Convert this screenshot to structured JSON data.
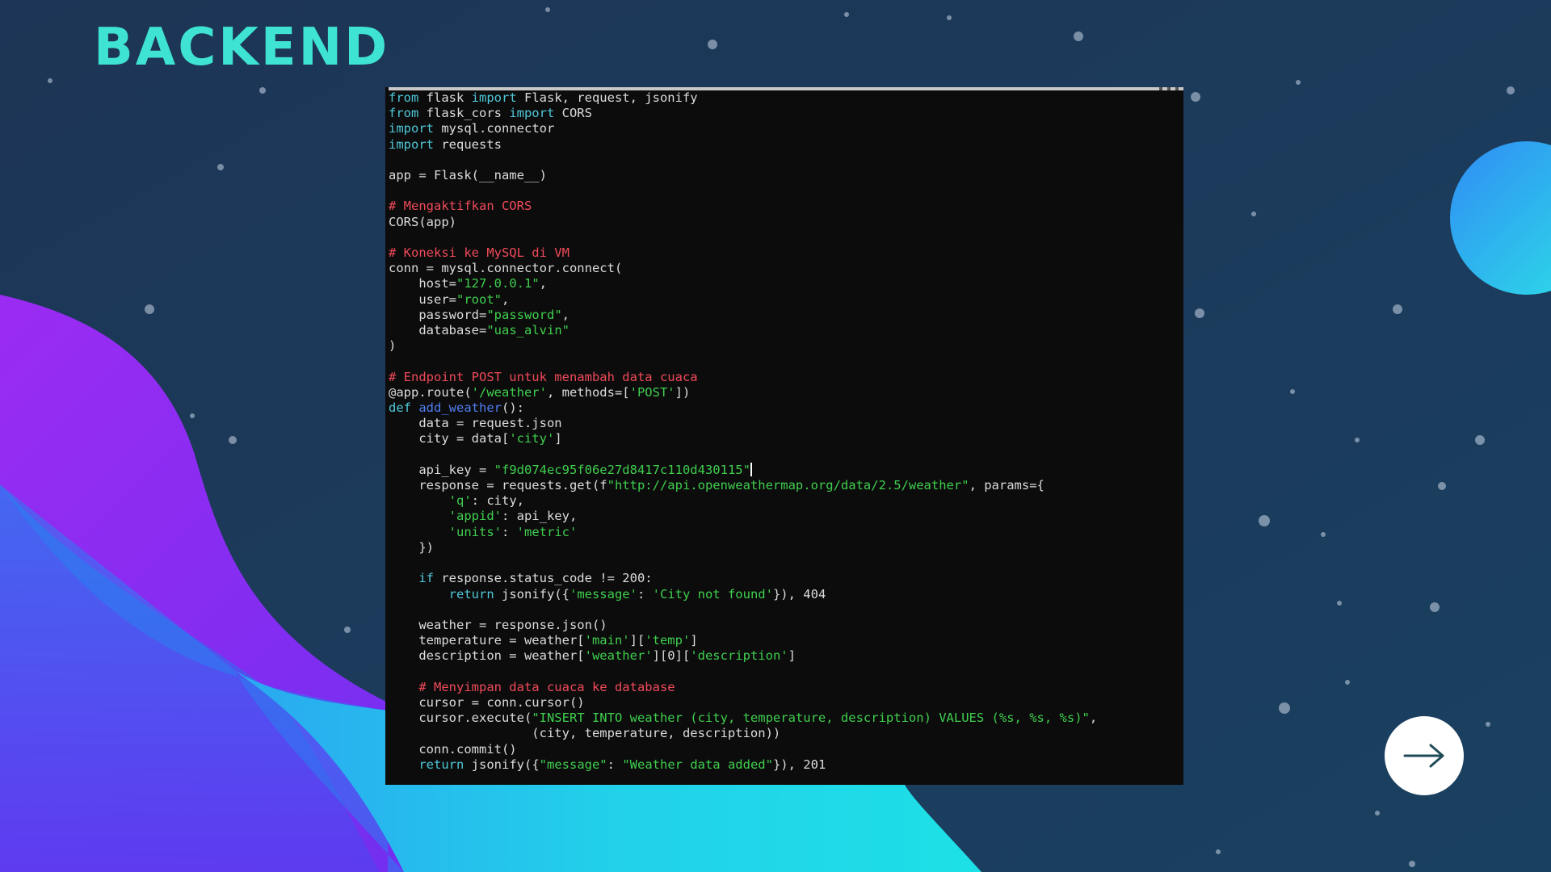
{
  "slide": {
    "title": "BACKEND",
    "accent_color": "#3ee3d4",
    "next_icon": "arrow-right-icon"
  },
  "code": {
    "lines": [
      [
        [
          "kw",
          "from"
        ],
        [
          "t",
          " flask "
        ],
        [
          "kw",
          "import"
        ],
        [
          "t",
          " Flask, request, jsonify"
        ]
      ],
      [
        [
          "kw",
          "from"
        ],
        [
          "t",
          " flask_cors "
        ],
        [
          "kw",
          "import"
        ],
        [
          "t",
          " CORS"
        ]
      ],
      [
        [
          "kw",
          "import"
        ],
        [
          "t",
          " mysql.connector"
        ]
      ],
      [
        [
          "kw",
          "import"
        ],
        [
          "t",
          " requests"
        ]
      ],
      [],
      [
        [
          "t",
          "app = Flask(__name__)"
        ]
      ],
      [],
      [
        [
          "cm",
          "# Mengaktifkan CORS"
        ]
      ],
      [
        [
          "t",
          "CORS(app)"
        ]
      ],
      [],
      [
        [
          "cm",
          "# Koneksi ke MySQL di VM"
        ]
      ],
      [
        [
          "t",
          "conn = mysql.connector.connect("
        ]
      ],
      [
        [
          "t",
          "    host="
        ],
        [
          "st",
          "\"127.0.0.1\""
        ],
        [
          "t",
          ","
        ]
      ],
      [
        [
          "t",
          "    user="
        ],
        [
          "st",
          "\"root\""
        ],
        [
          "t",
          ","
        ]
      ],
      [
        [
          "t",
          "    password="
        ],
        [
          "st",
          "\"password\""
        ],
        [
          "t",
          ","
        ]
      ],
      [
        [
          "t",
          "    database="
        ],
        [
          "st",
          "\"uas_alvin\""
        ]
      ],
      [
        [
          "t",
          ")"
        ]
      ],
      [],
      [
        [
          "cm",
          "# Endpoint POST untuk menambah data cuaca"
        ]
      ],
      [
        [
          "t",
          "@app.route("
        ],
        [
          "st",
          "'/weather'"
        ],
        [
          "t",
          ", methods=["
        ],
        [
          "st",
          "'POST'"
        ],
        [
          "t",
          "])"
        ]
      ],
      [
        [
          "kw",
          "def"
        ],
        [
          "t",
          " "
        ],
        [
          "fn",
          "add_weather"
        ],
        [
          "t",
          "():"
        ]
      ],
      [
        [
          "t",
          "    data = request.json"
        ]
      ],
      [
        [
          "t",
          "    city = data["
        ],
        [
          "st",
          "'city'"
        ],
        [
          "t",
          "]"
        ]
      ],
      [],
      [
        [
          "t",
          "    api_key = "
        ],
        [
          "st",
          "\"f9d074ec95f06e27d8417c110d430115\""
        ],
        [
          "caret",
          ""
        ]
      ],
      [
        [
          "t",
          "    response = requests.get(f"
        ],
        [
          "st",
          "\"http://api.openweathermap.org/data/2.5/weather\""
        ],
        [
          "t",
          ", params={"
        ]
      ],
      [
        [
          "t",
          "        "
        ],
        [
          "st",
          "'q'"
        ],
        [
          "t",
          ": city,"
        ]
      ],
      [
        [
          "t",
          "        "
        ],
        [
          "st",
          "'appid'"
        ],
        [
          "t",
          ": api_key,"
        ]
      ],
      [
        [
          "t",
          "        "
        ],
        [
          "st",
          "'units'"
        ],
        [
          "t",
          ": "
        ],
        [
          "st",
          "'metric'"
        ]
      ],
      [
        [
          "t",
          "    })"
        ]
      ],
      [],
      [
        [
          "t",
          "    "
        ],
        [
          "kw",
          "if"
        ],
        [
          "t",
          " response.status_code != 200:"
        ]
      ],
      [
        [
          "t",
          "        "
        ],
        [
          "kw",
          "return"
        ],
        [
          "t",
          " jsonify({"
        ],
        [
          "st",
          "'message'"
        ],
        [
          "t",
          ": "
        ],
        [
          "st",
          "'City not found'"
        ],
        [
          "t",
          "}), 404"
        ]
      ],
      [],
      [
        [
          "t",
          "    weather = response.json()"
        ]
      ],
      [
        [
          "t",
          "    temperature = weather["
        ],
        [
          "st",
          "'main'"
        ],
        [
          "t",
          "]["
        ],
        [
          "st",
          "'temp'"
        ],
        [
          "t",
          "]"
        ]
      ],
      [
        [
          "t",
          "    description = weather["
        ],
        [
          "st",
          "'weather'"
        ],
        [
          "t",
          "][0]["
        ],
        [
          "st",
          "'description'"
        ],
        [
          "t",
          "]"
        ]
      ],
      [],
      [
        [
          "t",
          "    "
        ],
        [
          "cm",
          "# Menyimpan data cuaca ke database"
        ]
      ],
      [
        [
          "t",
          "    cursor = conn.cursor()"
        ]
      ],
      [
        [
          "t",
          "    cursor.execute("
        ],
        [
          "st",
          "\"INSERT INTO weather (city, temperature, description) VALUES (%s, %s, %s)\""
        ],
        [
          "t",
          ","
        ]
      ],
      [
        [
          "t",
          "                   (city, temperature, description))"
        ]
      ],
      [
        [
          "t",
          "    conn.commit()"
        ]
      ],
      [
        [
          "t",
          "    "
        ],
        [
          "kw",
          "return"
        ],
        [
          "t",
          " jsonify({"
        ],
        [
          "st",
          "\"message\""
        ],
        [
          "t",
          ": "
        ],
        [
          "st",
          "\"Weather data added\""
        ],
        [
          "t",
          "}), 201"
        ]
      ]
    ]
  }
}
